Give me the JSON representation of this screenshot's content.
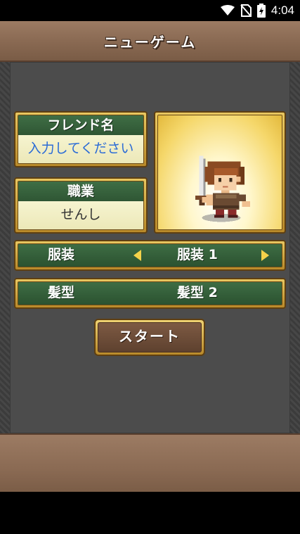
{
  "status_bar": {
    "time": "4:04",
    "icons": [
      "wifi-icon",
      "no-sim-icon",
      "battery-charging-icon"
    ]
  },
  "header": {
    "title": "ニューゲーム"
  },
  "friend_name": {
    "label": "フレンド名",
    "placeholder": "入力してください"
  },
  "job": {
    "label": "職業",
    "value": "せんし"
  },
  "outfit": {
    "label": "服装",
    "value": "服装 1"
  },
  "hairstyle": {
    "label": "髪型",
    "value": "髪型 2"
  },
  "start_button": {
    "label": "スタート"
  },
  "colors": {
    "panel_green": "#2f5634",
    "frame_gold": "#d4a83e",
    "header_brown": "#8a6a53",
    "placeholder_blue": "#2a6bd6"
  }
}
